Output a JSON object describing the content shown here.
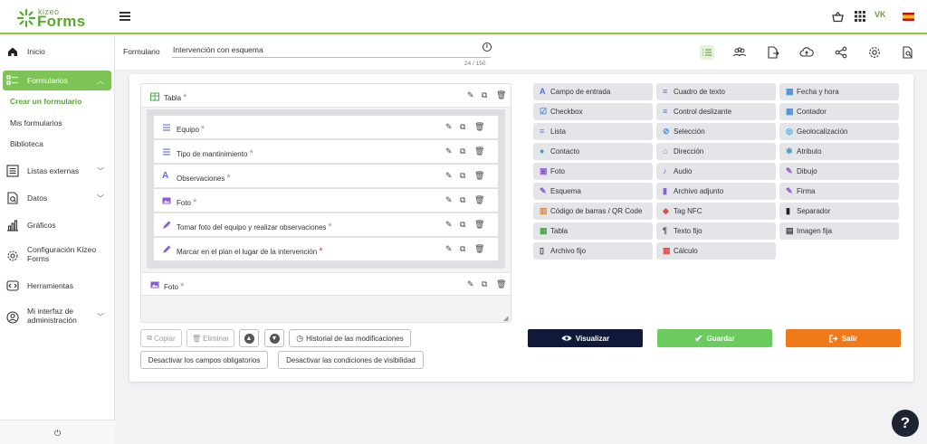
{
  "app": {
    "logo_top": "kizeo",
    "logo_bottom": "Forms",
    "user_initials": "VK",
    "language_flag": "spain-flag-icon"
  },
  "sidebar": {
    "items": [
      {
        "label": "Inicio",
        "icon": "home-icon"
      },
      {
        "label": "Formularios",
        "icon": "forms-list-icon"
      },
      {
        "label": "Listas externas",
        "icon": "list-icon"
      },
      {
        "label": "Datos",
        "icon": "data-icon"
      },
      {
        "label": "Gráficos",
        "icon": "chart-icon"
      },
      {
        "label": "Configuración Kizeo Forms",
        "icon": "gear-icon"
      },
      {
        "label": "Herramientas",
        "icon": "tools-icon"
      },
      {
        "label": "Mi interfaz de administración",
        "icon": "admin-icon"
      }
    ],
    "subitems": [
      "Crear un formulario",
      "Mis formularios",
      "Biblioteca"
    ],
    "power_glyph": "⏻"
  },
  "form_header": {
    "label": "Formulario",
    "name": "Intervención con esquema",
    "char_count": "24 / 150"
  },
  "canvas": {
    "table_label": "Tabla",
    "fields": [
      {
        "label": "Equipo",
        "icon": "text-lines-icon",
        "required": "*"
      },
      {
        "label": "Tipo de mantinimiento",
        "icon": "text-lines-icon",
        "required": "*"
      },
      {
        "label": "Observaciones",
        "icon": "text-A-icon",
        "required": "*"
      },
      {
        "label": "Foto",
        "icon": "photo-icon",
        "required": "*"
      },
      {
        "label": "Tomar foto del equipo y realizar observaciones",
        "icon": "pen-icon",
        "required": "*"
      },
      {
        "label": "Marcar en el plan el lugar de la intervención",
        "icon": "pen-icon",
        "required": "*"
      }
    ],
    "photo_label": "Foto",
    "required_mark": "*"
  },
  "buttons": {
    "copy": "Copiar",
    "delete": "Eliminar",
    "history": "Historial de las modificaciones",
    "disable_required": "Desactivar los campos obligatorios",
    "disable_visibility": "Desactivar las condiciones de visibilidad"
  },
  "palette": [
    {
      "label": "Campo de entrada",
      "color": "#5b6fd6"
    },
    {
      "label": "Cuadro de texto",
      "color": "#5b6fd6"
    },
    {
      "label": "Fecha y hora",
      "color": "#4a90d9"
    },
    {
      "label": "Checkbox",
      "color": "#4a90d9"
    },
    {
      "label": "Control deslizante",
      "color": "#5b6fd6"
    },
    {
      "label": "Contador",
      "color": "#4a90d9"
    },
    {
      "label": "Lista",
      "color": "#4a90d9"
    },
    {
      "label": "Selección",
      "color": "#4a90d9"
    },
    {
      "label": "Geolocalización",
      "color": "#4aa3c9"
    },
    {
      "label": "Contacto",
      "color": "#4a90d9"
    },
    {
      "label": "Dirección",
      "color": "#4aa3c9"
    },
    {
      "label": "Atributo",
      "color": "#4aa3c9"
    },
    {
      "label": "Foto",
      "color": "#8e5bd6"
    },
    {
      "label": "Audio",
      "color": "#8e5bd6"
    },
    {
      "label": "Dibujo",
      "color": "#8e5bd6"
    },
    {
      "label": "Esquema",
      "color": "#8e5bd6"
    },
    {
      "label": "Archivo adjunto",
      "color": "#8e5bd6"
    },
    {
      "label": "Firma",
      "color": "#8e5bd6"
    },
    {
      "label": "Código de barras / QR Code",
      "color": "#d98b3a"
    },
    {
      "label": "Tag NFC",
      "color": "#e0504f"
    },
    {
      "label": "Separador",
      "color": "#222222"
    },
    {
      "label": "Tabla",
      "color": "#4aa84a"
    },
    {
      "label": "Texto fijo",
      "color": "#444444"
    },
    {
      "label": "Imagen fija",
      "color": "#444444"
    },
    {
      "label": "Archivo fijo",
      "color": "#444444"
    },
    {
      "label": "Cálculo",
      "color": "#e0504f"
    }
  ],
  "actions": {
    "preview": "Visualizar",
    "save": "Guardar",
    "exit": "Salir"
  },
  "colors": {
    "brand_green": "#7dc356",
    "preview_bg": "#0f1a3a",
    "save_bg": "#6ccb5f",
    "exit_bg": "#f07a1a"
  },
  "help_glyph": "?"
}
